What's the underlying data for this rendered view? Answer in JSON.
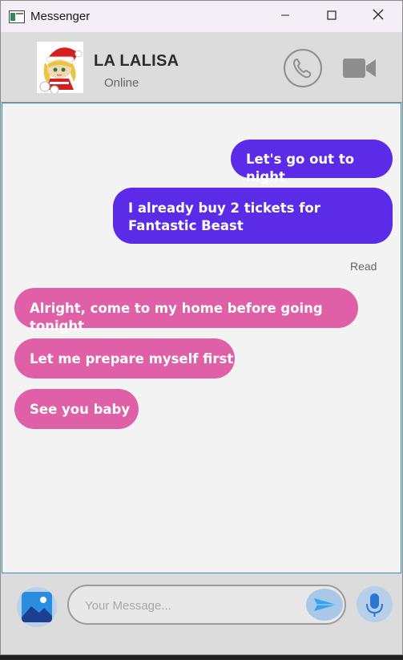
{
  "window": {
    "title": "Messenger",
    "icon": "app-window-icon",
    "controls": [
      "minimize-icon",
      "maximize-icon",
      "close-icon"
    ]
  },
  "header": {
    "contact_name": "LA LALISA",
    "status": "Online",
    "actions": [
      "phone-call-icon",
      "video-camera-icon"
    ]
  },
  "messages": [
    {
      "direction": "sent",
      "text": "Let's go out to night"
    },
    {
      "direction": "sent",
      "text": "I already buy 2 tickets for Fantastic Beast"
    },
    {
      "direction": "received",
      "text": "Alright, come to my home before going tonight"
    },
    {
      "direction": "received",
      "text": "Let me prepare myself first"
    },
    {
      "direction": "received",
      "text": "See you baby"
    }
  ],
  "read_receipt": "Read",
  "input_bar": {
    "placeholder": "Your Message...",
    "value": "",
    "buttons": [
      "image-gallery-icon",
      "send-icon",
      "microphone-icon"
    ]
  },
  "colors": {
    "sent_bubble": "#5b2be8",
    "received_bubble": "#e060a8",
    "chat_background": "#f3f3f3",
    "header_background": "#dcdcdc"
  }
}
